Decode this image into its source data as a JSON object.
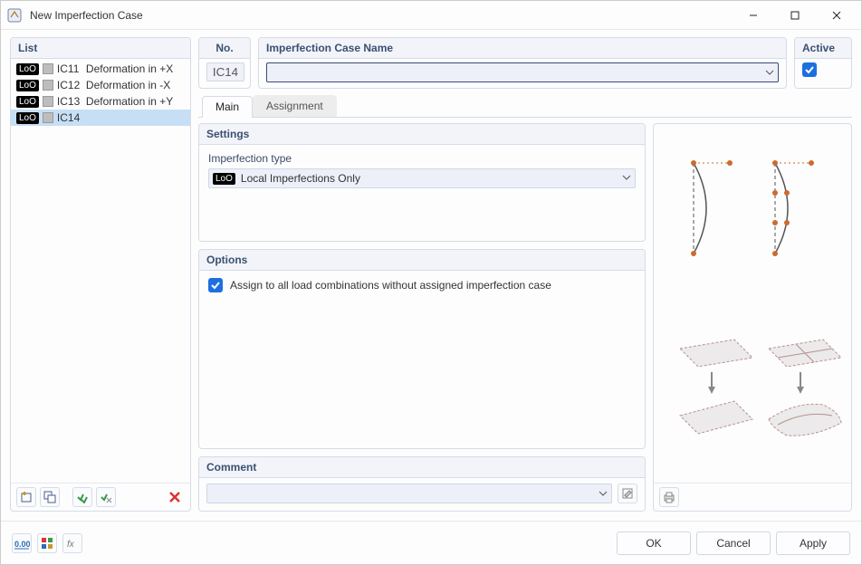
{
  "window": {
    "title": "New Imperfection Case"
  },
  "list": {
    "header": "List",
    "badge": "LoO",
    "items": [
      {
        "id": "IC11",
        "name": "Deformation in +X",
        "selected": false
      },
      {
        "id": "IC12",
        "name": "Deformation in -X",
        "selected": false
      },
      {
        "id": "IC13",
        "name": "Deformation in +Y",
        "selected": false
      },
      {
        "id": "IC14",
        "name": "IC14",
        "selected": true
      }
    ]
  },
  "no": {
    "label": "No.",
    "value": "IC14"
  },
  "case_name": {
    "label": "Imperfection Case Name",
    "value": ""
  },
  "active": {
    "label": "Active",
    "checked": true
  },
  "tabs": {
    "main": "Main",
    "assignment": "Assignment",
    "active": "main"
  },
  "settings": {
    "header": "Settings",
    "type_label": "Imperfection type",
    "type_badge": "LoO",
    "type_value": "Local Imperfections Only"
  },
  "options": {
    "header": "Options",
    "assign_all": {
      "checked": true,
      "label": "Assign to all load combinations without assigned imperfection case"
    }
  },
  "comment": {
    "header": "Comment",
    "value": ""
  },
  "buttons": {
    "ok": "OK",
    "cancel": "Cancel",
    "apply": "Apply"
  },
  "colors": {
    "accent": "#1d6fe0",
    "panel_header_bg": "#f2f4fa",
    "panel_border": "#d6dbe8",
    "selected_bg": "#c7dff5"
  },
  "preview": {
    "description": "Illustrations: two curved/bowed member imperfection sketches (top) and two deformed surface sketches with downward arrows (bottom)."
  }
}
